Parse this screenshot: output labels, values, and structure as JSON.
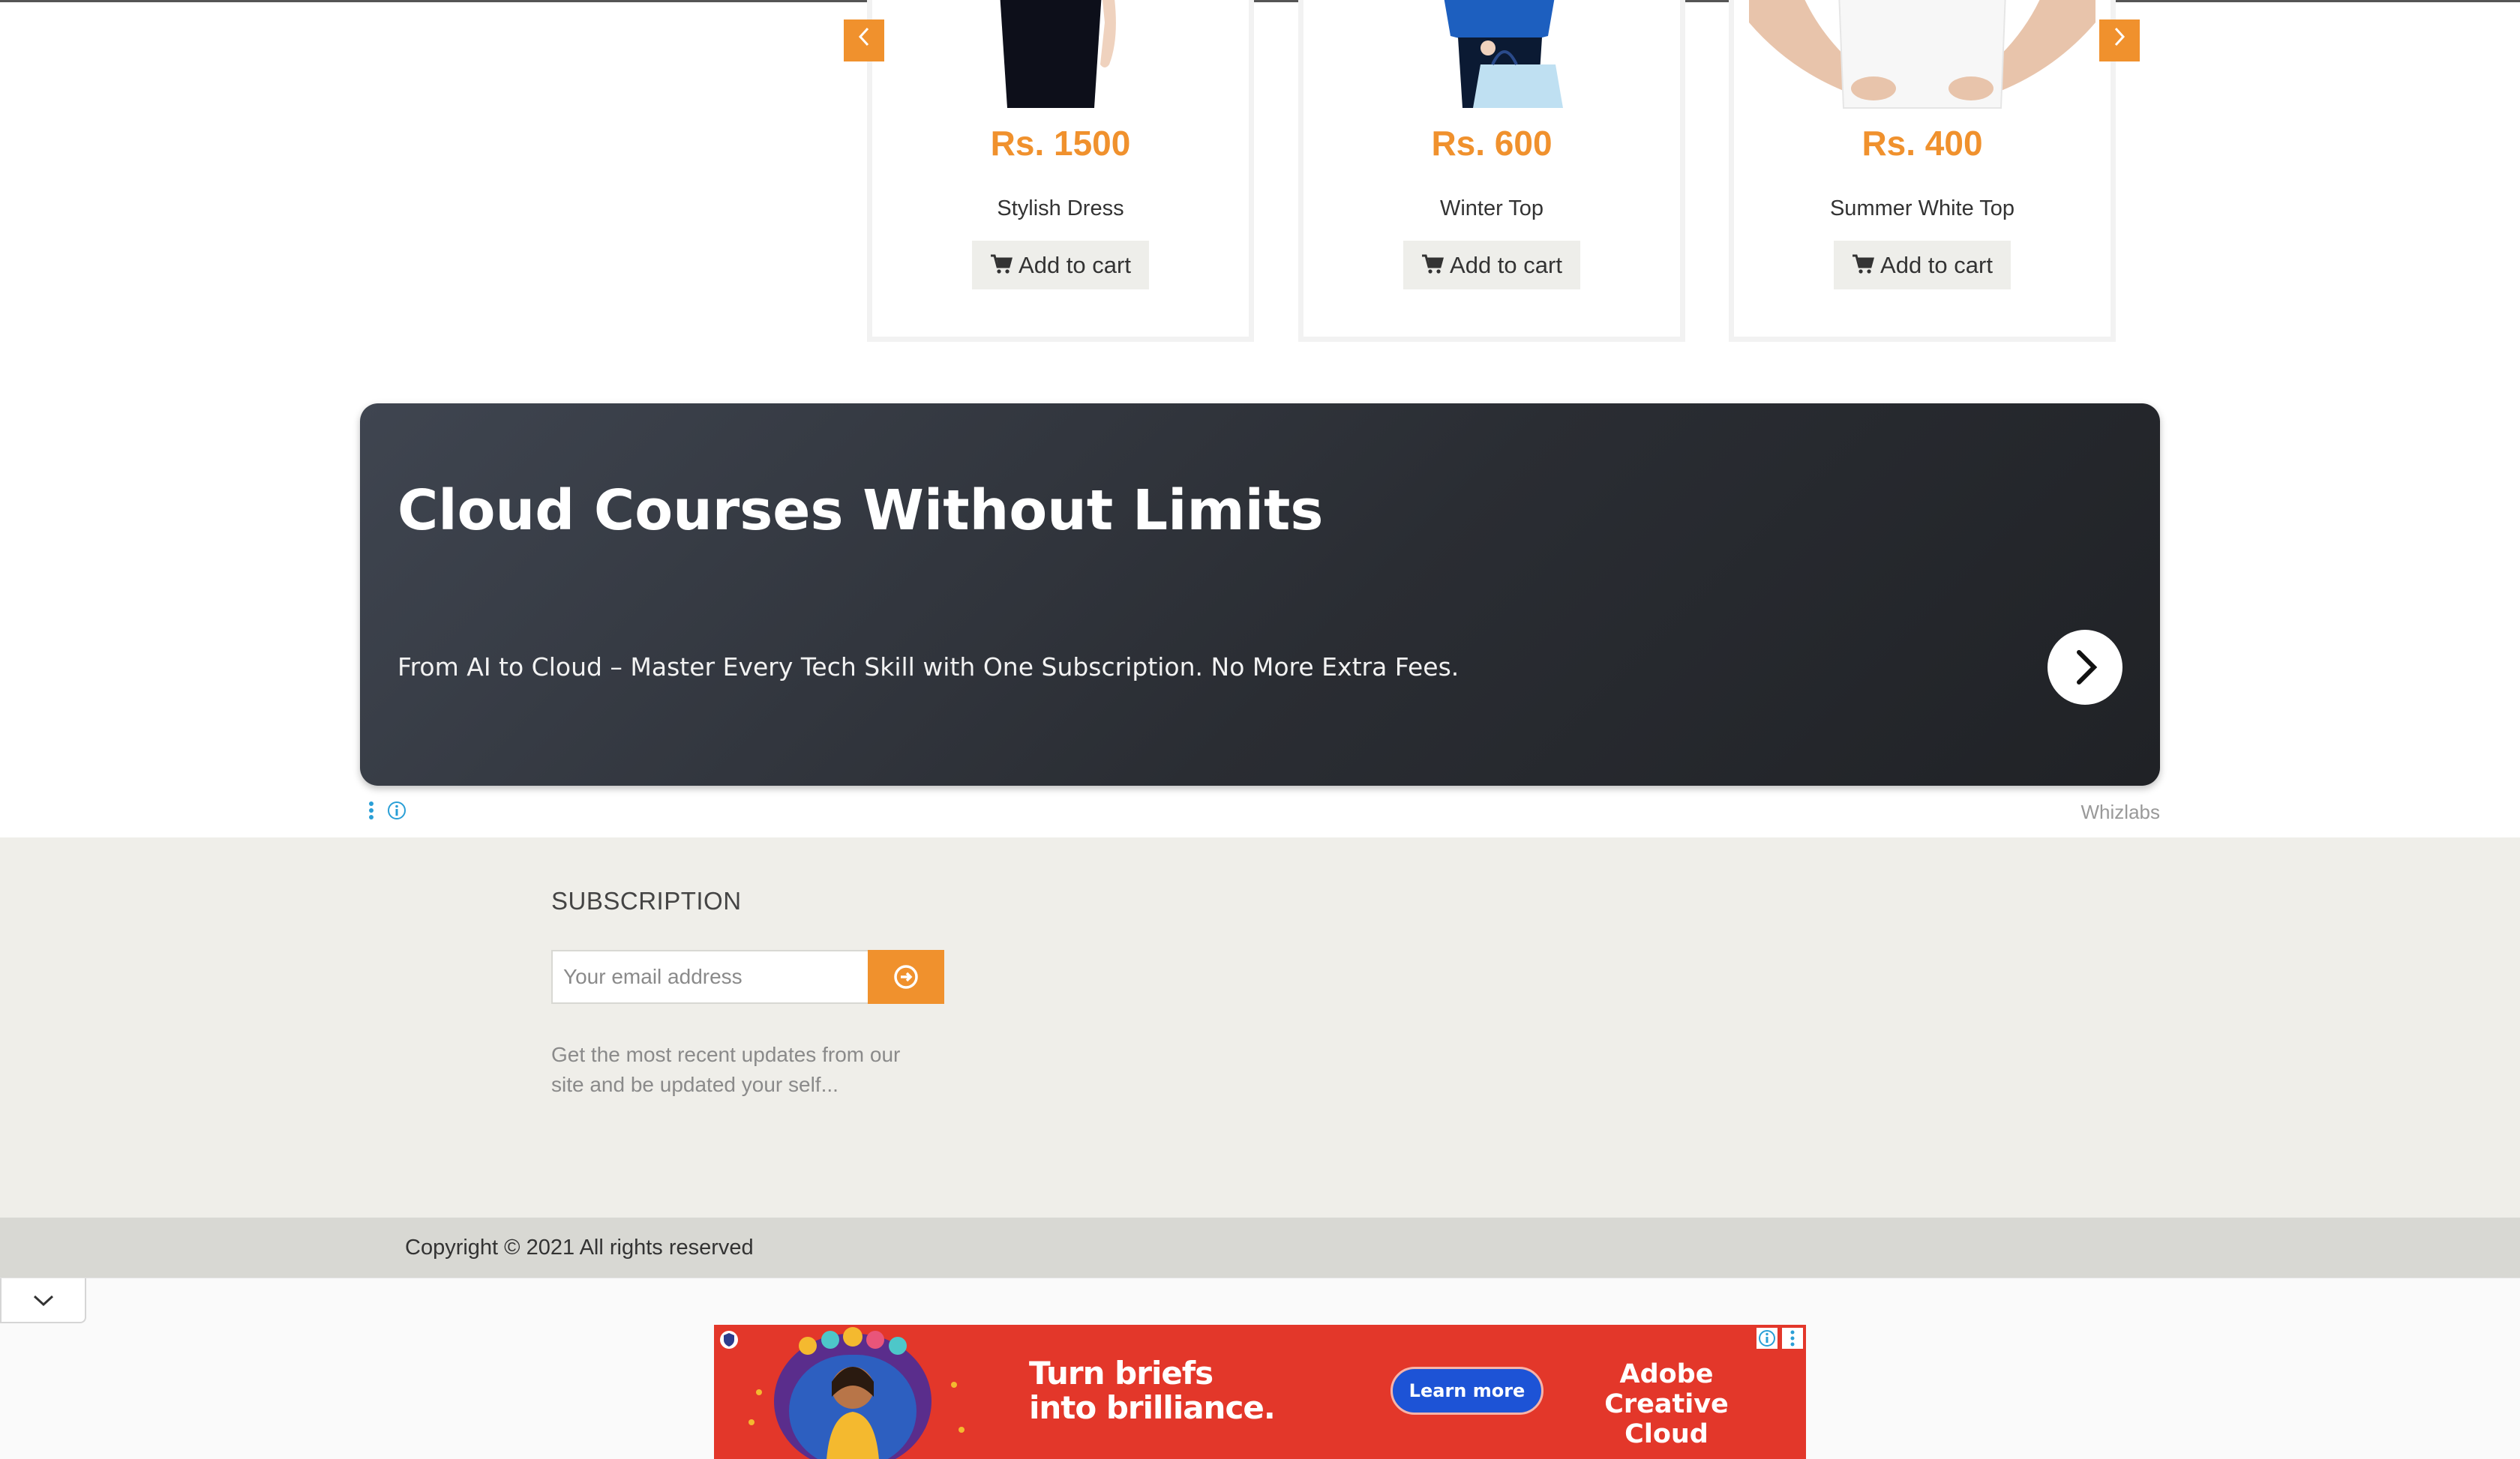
{
  "carousel": {
    "prev_icon": "chevron-left-icon",
    "next_icon": "chevron-right-icon",
    "products": [
      {
        "price": "Rs. 1500",
        "name": "Stylish Dress",
        "cart_label": "Add to cart"
      },
      {
        "price": "Rs. 600",
        "name": "Winter Top",
        "cart_label": "Add to cart"
      },
      {
        "price": "Rs. 400",
        "name": "Summer White Top",
        "cart_label": "Add to cart"
      }
    ]
  },
  "ad": {
    "title": "Cloud Courses Without Limits",
    "description": "From AI to Cloud – Master Every Tech Skill with One Subscription. No More Extra Fees.",
    "sponsor": "Whizlabs"
  },
  "footer": {
    "subscription_title": "SUBSCRIPTION",
    "email_placeholder": "Your email address",
    "description": "Get the most recent updates from our site and be updated your self...",
    "copyright": "Copyright © 2021 All rights reserved"
  },
  "sticky_ad": {
    "headline_line1": "Turn briefs",
    "headline_line2": "into brilliance.",
    "cta": "Learn more",
    "brand_line1": "Adobe",
    "brand_line2": "Creative Cloud"
  },
  "colors": {
    "accent": "#f0912d",
    "footer_bg": "#efeee9",
    "copyright_bg": "#d8d8d3",
    "ad_bg": "#2a2d33",
    "sticky_ad_bg": "#e3372a"
  }
}
